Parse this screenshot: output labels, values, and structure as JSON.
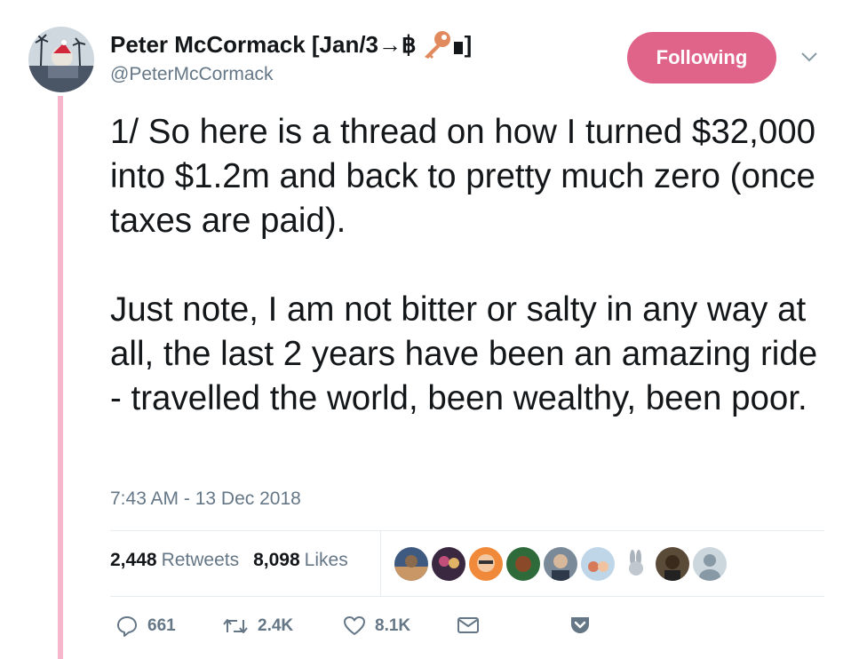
{
  "tweet": {
    "author": {
      "display_name": "Peter McCormack [Jan/3→฿",
      "display_name_end": "]",
      "handle": "@PeterMcCormack",
      "avatar": "avatar-image"
    },
    "follow_button_label": "Following",
    "menu_icon": "chevron-down-icon",
    "paragraphs": [
      "1/ So here is a thread on how I turned $32,000 into $1.2m and back to pretty much zero (once taxes are paid).",
      "Just note, I am not bitter or salty in any way at all, the last 2 years have been an amazing ride - travelled the world, been wealthy, been poor."
    ],
    "timestamp": "7:43 AM - 13 Dec 2018",
    "stats": {
      "retweets_count": "2,448",
      "retweets_label": "Retweets",
      "likes_count": "8,098",
      "likes_label": "Likes"
    },
    "actions": {
      "reply_count": "661",
      "retweet_count": "2.4K",
      "like_count": "8.1K"
    }
  },
  "colors": {
    "accent": "#e0648a",
    "thread_line": "#f6b6cc",
    "secondary_text": "#657786"
  }
}
